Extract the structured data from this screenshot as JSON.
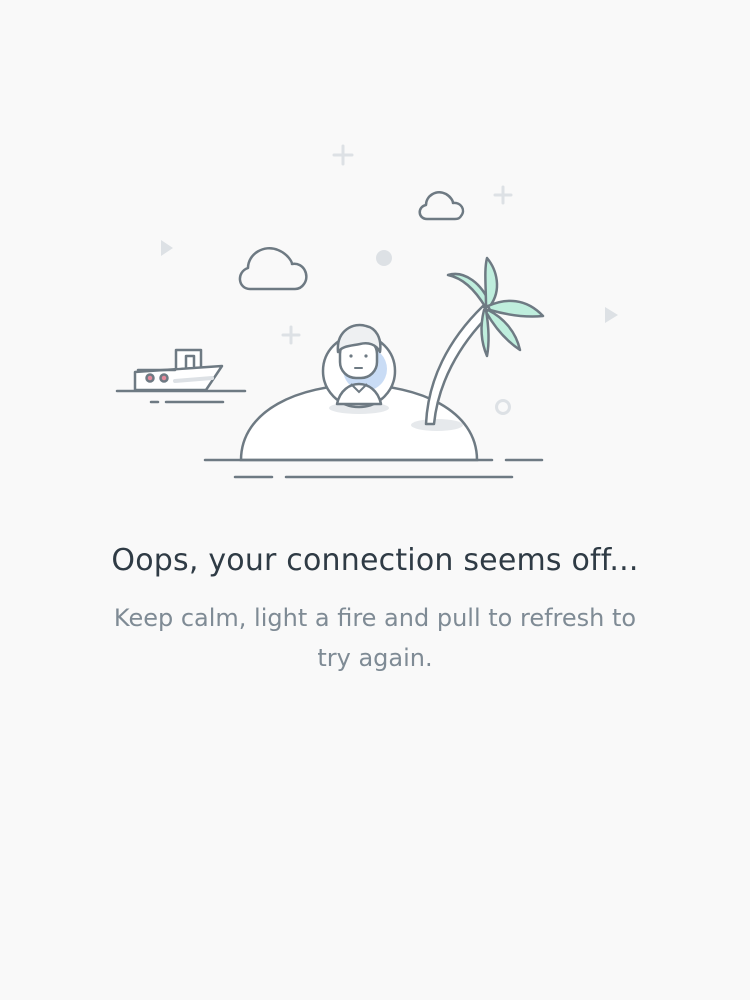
{
  "empty_state": {
    "title": "Oops, your connection seems off...",
    "message": "Keep calm, light a fire and pull to refresh to try again.",
    "illustration_name": "castaway-island-illustration"
  },
  "colors": {
    "background": "#f9f9f9",
    "title_text": "#2f3b45",
    "body_text": "#7f8b95",
    "outline": "#6e7a83",
    "palm_leaf": "#bfeedd",
    "avatar_bg": "#c9dcf5",
    "decor": "#dde1e5"
  }
}
